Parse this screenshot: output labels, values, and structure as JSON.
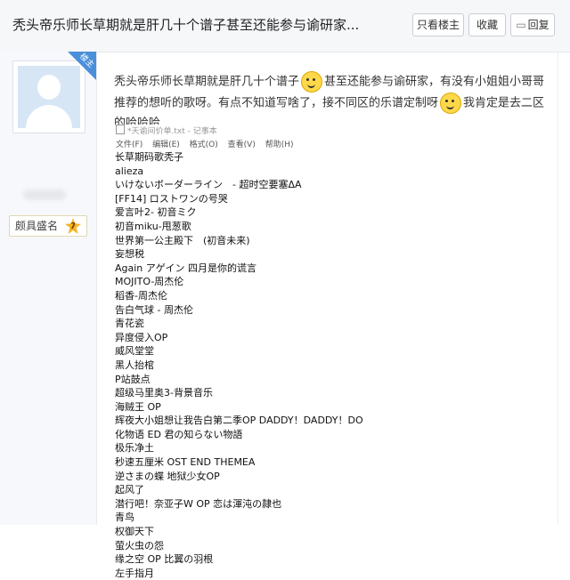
{
  "header": {
    "title": "秃头帝乐师长草期就是肝几十个谱子甚至还能参与谕研家...",
    "only_op_label": "只看楼主",
    "favorite_label": "收藏",
    "reply_label": "回复",
    "reply_icon": "speech-bubble-icon"
  },
  "user": {
    "corner_badge": "楼主",
    "title_badge": "颇具盛名",
    "level": "7"
  },
  "post": {
    "text_part1": "秃头帝乐师长草期就是肝几十个谱子",
    "text_part2": "甚至还能参与谕研家，有没有小姐姐小哥哥推荐的想听的歌呀。有点不知道写啥了，接不同区的乐谱定制呀",
    "text_part3": "我肯定是去二区的哈哈哈"
  },
  "notepad": {
    "window_title": "*天谕间价单.txt - 记事本",
    "menu": [
      "文件(F)",
      "编辑(E)",
      "格式(O)",
      "查看(V)",
      "帮助(H)"
    ],
    "lines": [
      "长草期码歌秃子",
      "alieza",
      "いけないボーダーライン　- 超时空要塞ΔA",
      "[FF14] ロストワンの号哭",
      "爱言叶2- 初音ミク",
      "初音miku-甩葱歌",
      "世界第一公主殿下　(初音未来)",
      "妄想税",
      "Again アゲイン 四月是你的谎言",
      "MOJITO-周杰伦",
      "稻香-周杰伦",
      "告白气球 - 周杰伦",
      "青花瓷",
      "异度侵入OP",
      "威风堂堂",
      "黑人抬棺",
      "P站鼓点",
      "超级马里奥3-背景音乐",
      "海贼王 OP",
      "辉夜大小姐想让我告白第二季OP DADDY！DADDY！DO",
      "化物语 ED 君の知らない物語",
      "极乐净土",
      "秒速五厘米 OST END THEMEA",
      "逆さまの蝶 地狱少女OP",
      "起风了",
      "潜行吧！奈亚子W OP 恋は渾沌の隷也",
      "青鸟",
      "权御天下",
      "萤火虫の怨",
      "缘之空 OP 比翼の羽根",
      "左手指月"
    ]
  }
}
